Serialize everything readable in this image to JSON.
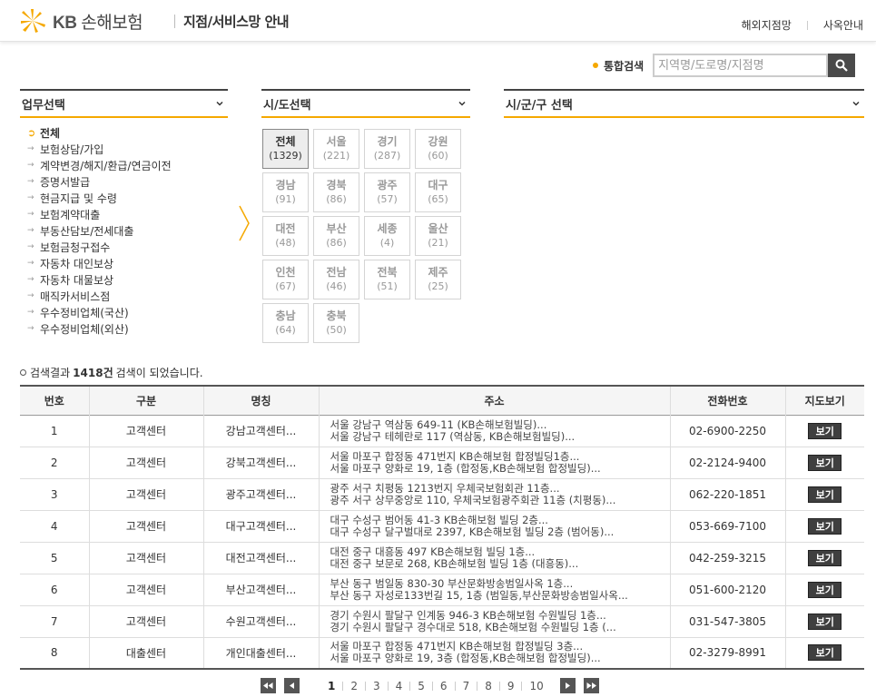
{
  "header": {
    "logo_kb": "KB",
    "logo_name": "손해보험",
    "title": "지점/서비스망 안내",
    "links": [
      "해외지점망",
      "사옥안내"
    ]
  },
  "search": {
    "label": "통합검색",
    "placeholder": "지역명/도로명/지점명"
  },
  "panels": {
    "business": "업무선택",
    "province": "시/도선택",
    "district": "시/군/구 선택"
  },
  "business_items": [
    {
      "label": "전체",
      "active": true
    },
    {
      "label": "보험상담/가입"
    },
    {
      "label": "계약변경/해지/환급/연금이전"
    },
    {
      "label": "증명서발급"
    },
    {
      "label": "현금지급 및 수령"
    },
    {
      "label": "보험계약대출"
    },
    {
      "label": "부동산담보/전세대출"
    },
    {
      "label": "보험금청구접수"
    },
    {
      "label": "자동차 대인보상"
    },
    {
      "label": "자동차 대물보상"
    },
    {
      "label": "매직카서비스점"
    },
    {
      "label": "우수정비업체(국산)"
    },
    {
      "label": "우수정비업체(외산)"
    }
  ],
  "regions": [
    {
      "name": "전체",
      "count": "(1329)",
      "active": true
    },
    {
      "name": "서울",
      "count": "(221)"
    },
    {
      "name": "경기",
      "count": "(287)"
    },
    {
      "name": "강원",
      "count": "(60)"
    },
    {
      "name": "경남",
      "count": "(91)"
    },
    {
      "name": "경북",
      "count": "(86)"
    },
    {
      "name": "광주",
      "count": "(57)"
    },
    {
      "name": "대구",
      "count": "(65)"
    },
    {
      "name": "대전",
      "count": "(48)"
    },
    {
      "name": "부산",
      "count": "(86)"
    },
    {
      "name": "세종",
      "count": "(4)"
    },
    {
      "name": "울산",
      "count": "(21)"
    },
    {
      "name": "인천",
      "count": "(67)"
    },
    {
      "name": "전남",
      "count": "(46)"
    },
    {
      "name": "전북",
      "count": "(51)"
    },
    {
      "name": "제주",
      "count": "(25)"
    },
    {
      "name": "충남",
      "count": "(64)"
    },
    {
      "name": "충북",
      "count": "(50)"
    }
  ],
  "result": {
    "prefix": "검색결과",
    "count": "1418건",
    "suffix": "검색이 되었습니다."
  },
  "table": {
    "headers": [
      "번호",
      "구분",
      "명칭",
      "주소",
      "전화번호",
      "지도보기"
    ],
    "view_label": "보기",
    "rows": [
      {
        "no": "1",
        "type": "고객센터",
        "name": "강남고객센터...",
        "addr1": "서울 강남구 역삼동 649-11 (KB손해보험빌딩)...",
        "addr2": "서울 강남구 테헤란로 117 (역삼동, KB손해보험빌딩)...",
        "phone": "02-6900-2250"
      },
      {
        "no": "2",
        "type": "고객센터",
        "name": "강북고객센터...",
        "addr1": "서울 마포구 합정동 471번지 KB손해보험 합정빌딩1층...",
        "addr2": "서울 마포구 양화로 19, 1층 (합정동,KB손해보험 합정빌딩)...",
        "phone": "02-2124-9400"
      },
      {
        "no": "3",
        "type": "고객센터",
        "name": "광주고객센터...",
        "addr1": "광주 서구 치평동 1213번지 우체국보험회관 11층...",
        "addr2": "광주 서구 상무중앙로 110, 우체국보험광주회관 11층 (치평동)...",
        "phone": "062-220-1851"
      },
      {
        "no": "4",
        "type": "고객센터",
        "name": "대구고객센터...",
        "addr1": "대구 수성구 범어동 41-3 KB손해보험 빌딩 2층...",
        "addr2": "대구 수성구 달구벌대로 2397, KB손해보험 빌딩 2층 (범어동)...",
        "phone": "053-669-7100"
      },
      {
        "no": "5",
        "type": "고객센터",
        "name": "대전고객센터...",
        "addr1": "대전 중구 대흥동 497 KB손해보험 빌딩 1층...",
        "addr2": "대전 중구 보문로 268, KB손해보험 빌딩 1층 (대흥동)...",
        "phone": "042-259-3215"
      },
      {
        "no": "6",
        "type": "고객센터",
        "name": "부산고객센터...",
        "addr1": "부산 동구 범일동 830-30 부산문화방송범일사옥 1층...",
        "addr2": "부산 동구 자성로133번길 15, 1층 (범일동,부산문화방송범일사옥...",
        "phone": "051-600-2120"
      },
      {
        "no": "7",
        "type": "고객센터",
        "name": "수원고객센터...",
        "addr1": "경기 수원시 팔달구 인계동 946-3 KB손해보험 수원빌딩 1층...",
        "addr2": "경기 수원시 팔달구 경수대로 518, KB손해보험 수원빌딩 1층 (...",
        "phone": "031-547-3805"
      },
      {
        "no": "8",
        "type": "대출센터",
        "name": "개인대출센터...",
        "addr1": "서울 마포구 합정동 471번지 KB손해보험 합정빌딩 3층...",
        "addr2": "서울 마포구 양화로 19, 3층 (합정동,KB손해보험 합정빌딩)...",
        "phone": "02-3279-8991"
      }
    ]
  },
  "pagination": {
    "pages": [
      "1",
      "2",
      "3",
      "4",
      "5",
      "6",
      "7",
      "8",
      "9",
      "10"
    ],
    "current": "1"
  },
  "colors": {
    "accent": "#f5a800",
    "dark": "#444444"
  }
}
